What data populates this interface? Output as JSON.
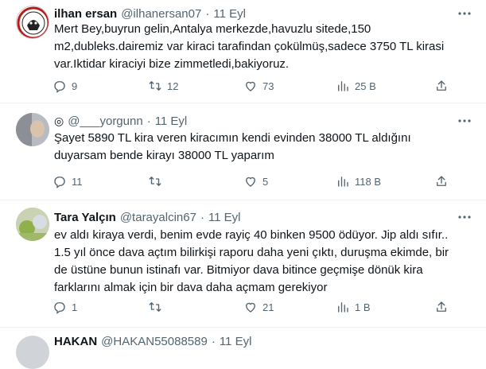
{
  "tweets": [
    {
      "name": "ilhan ersan",
      "handle": "@ilhanersan07",
      "dot": "·",
      "date": "11 Eyl",
      "text": "Mert Bey,buyrun gelin,Antalya merkezde,havuzlu sitede,150\nm2,dubleks.dairemiz var kiraci tarafindan çokülmüş,sadece 3750 TL kirasi\nvar.Iktidar kiraciyi bize zimmetledi,bakiyoruz.",
      "replies": "9",
      "reposts": "12",
      "likes": "73",
      "views": "25 B"
    },
    {
      "name": "",
      "handle": "@___yorgunn",
      "dot": "·",
      "date": "11 Eyl",
      "badge": "◎",
      "text": "Şayet 5890 TL kira veren kiracımın kendi evinden 38000 TL aldığını\nduyarsam bende kirayı 38000 TL yaparım",
      "replies": "11",
      "reposts": "",
      "likes": "5",
      "views": "118 B"
    },
    {
      "name": "Tara Yalçın",
      "handle": "@tarayalcin67",
      "dot": "·",
      "date": "11 Eyl",
      "text": "ev aldı kiraya verdi, benim evde rayiç 40 binken 9500 ödüyor. Jip aldı sıfır..\n1.5 yıl önce dava açtım bilirkişi raporu daha yeni çıktı, duruşma ekimde, bir\nde üstüne bunun istinafı var. Bitmiyor dava bitince geçmişe dönük kira\nfarklarını almak için bir dava daha açmam gerekiyor",
      "replies": "1",
      "reposts": "",
      "likes": "21",
      "views": "1 B"
    },
    {
      "name": "HAKAN",
      "handle": "@HAKAN55088589",
      "dot": "·",
      "date": "11 Eyl"
    }
  ],
  "colors": {
    "text": "#0f1419",
    "muted": "#536471",
    "border": "#eff3f4"
  }
}
